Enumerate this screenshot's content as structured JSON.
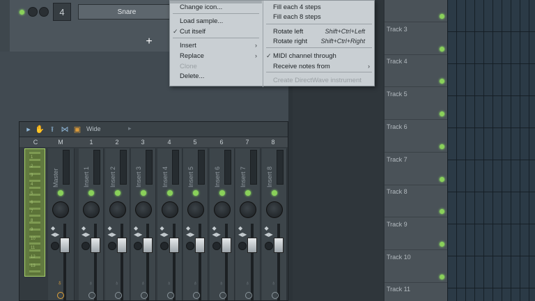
{
  "channel_rack": {
    "channel_number": "4",
    "channel_name": "Snare",
    "add_label": "+"
  },
  "context_menu": {
    "left_items": [
      {
        "label": "Change icon...",
        "disabled": false,
        "submenu": false,
        "checked": false
      },
      {
        "label": "Load sample...",
        "disabled": false,
        "submenu": false,
        "checked": false
      },
      {
        "label": "Cut itself",
        "disabled": false,
        "submenu": false,
        "checked": true
      },
      {
        "label": "Insert",
        "disabled": false,
        "submenu": true,
        "checked": false
      },
      {
        "label": "Replace",
        "disabled": false,
        "submenu": true,
        "checked": false
      },
      {
        "label": "Clone",
        "disabled": true,
        "submenu": false,
        "checked": false
      },
      {
        "label": "Delete...",
        "disabled": false,
        "submenu": false,
        "checked": false
      }
    ],
    "right_items": [
      {
        "label": "Fill each 4 steps",
        "shortcut": "",
        "disabled": false,
        "submenu": false,
        "checked": false
      },
      {
        "label": "Fill each 8 steps",
        "shortcut": "",
        "disabled": false,
        "submenu": false,
        "checked": false
      },
      {
        "label": "Rotate left",
        "shortcut": "Shift+Ctrl+Left",
        "disabled": false,
        "submenu": false,
        "checked": false
      },
      {
        "label": "Rotate right",
        "shortcut": "Shift+Ctrl+Right",
        "disabled": false,
        "submenu": false,
        "checked": false
      },
      {
        "label": "MIDI channel through",
        "shortcut": "",
        "disabled": false,
        "submenu": false,
        "checked": true
      },
      {
        "label": "Receive notes from",
        "shortcut": "",
        "disabled": false,
        "submenu": true,
        "checked": false
      },
      {
        "label": "Create DirectWave instrument",
        "shortcut": "",
        "disabled": true,
        "submenu": false,
        "checked": false
      }
    ]
  },
  "mixer": {
    "toolbar_mode": "Wide",
    "header": [
      "C",
      "M",
      "1",
      "2",
      "3",
      "4",
      "5",
      "6",
      "7",
      "8"
    ],
    "current_meter_labels": [
      "1",
      "2",
      "3",
      "4",
      "5",
      "6",
      "7",
      "8",
      "9",
      "10",
      "11",
      "12",
      "13"
    ],
    "master_label": "Master",
    "inserts": [
      "Insert 1",
      "Insert 2",
      "Insert 3",
      "Insert 4",
      "Insert 5",
      "Insert 6",
      "Insert 7",
      "Insert 8"
    ]
  },
  "playlist": {
    "tracks": [
      "",
      "Track 3",
      "Track 4",
      "Track 5",
      "Track 6",
      "Track 7",
      "Track 8",
      "Track 9",
      "Track 10",
      "Track 11"
    ]
  },
  "colors": {
    "accent_led": "#8ad05a",
    "menu_bg": "#c9cfd3",
    "current_strip": "#627a40"
  }
}
